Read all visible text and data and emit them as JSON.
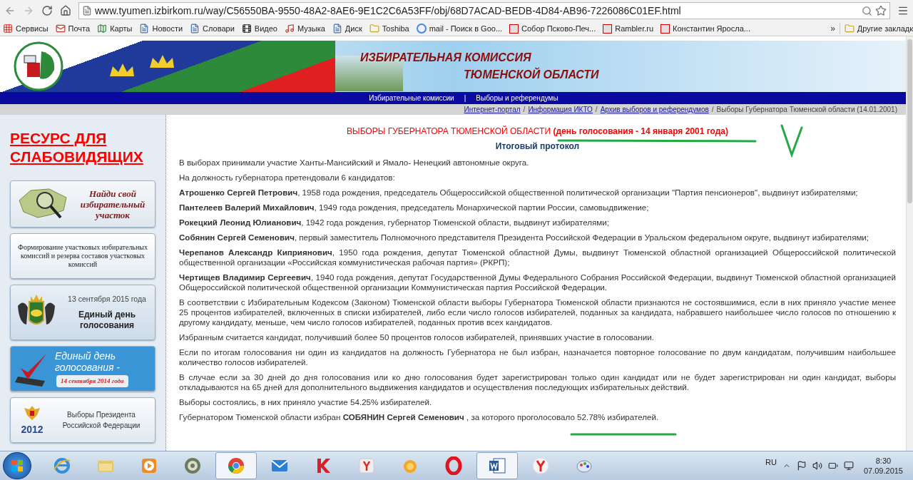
{
  "browser": {
    "url": "www.tyumen.izbirkom.ru/way/C56550BA-9550-48A2-8AE6-9E1C2C6A53FF/obj/68D7ACAD-BEDB-4D84-AB96-7226086C01EF.html",
    "bookmarks": [
      {
        "label": "Сервисы",
        "kind": "apps"
      },
      {
        "label": "Почта",
        "kind": "mail"
      },
      {
        "label": "Карты",
        "kind": "maps"
      },
      {
        "label": "Новости",
        "kind": "page"
      },
      {
        "label": "Словари",
        "kind": "page"
      },
      {
        "label": "Видео",
        "kind": "video"
      },
      {
        "label": "Музыка",
        "kind": "music"
      },
      {
        "label": "Диск",
        "kind": "page"
      },
      {
        "label": "Toshiba",
        "kind": "folder"
      },
      {
        "label": "mail - Поиск в Goo...",
        "kind": "google"
      },
      {
        "label": "Собор Псково-Печ...",
        "kind": "yandex"
      },
      {
        "label": "Rambler.ru",
        "kind": "yandex"
      },
      {
        "label": "Константин Яросла...",
        "kind": "yandex"
      }
    ],
    "more": "»",
    "other_bookmarks": "Другие закладк"
  },
  "site_header": {
    "title_lines": [
      "ИЗБИРАТЕЛЬНАЯ КОМИССИЯ",
      "ТЮМЕНСКОЙ ОБЛАСТИ"
    ]
  },
  "nav": {
    "links": [
      "Избирательные комиссии",
      "Выборы и референдумы"
    ],
    "separator": "|"
  },
  "breadcrumbs": {
    "links": [
      "Интернет-портал",
      "Информация ИКТО",
      "Архив выборов и референдумов"
    ],
    "separator": "/",
    "current": "Выборы Губернатора Тюменской области (14.01.2001)"
  },
  "sidebar": {
    "accessibility_link": "РЕСУРС ДЛЯ СЛАБОВИДЯЩИХ",
    "banners": [
      {
        "kind": "map",
        "title": "Найди свой избирательный участок"
      },
      {
        "kind": "text",
        "title": "Формирование участковых избирательных комиссий и резерва составов участковых комиссий"
      },
      {
        "kind": "emblem",
        "date": "13 сентября 2015 года",
        "title": "Единый день голосования"
      },
      {
        "kind": "ballot",
        "title": "Единый день голосования -",
        "date": "14 сентября 2014 года"
      },
      {
        "kind": "president",
        "date": "2012",
        "title": "Выборы Президента Российской Федерации"
      }
    ]
  },
  "article": {
    "title": "ВЫБОРЫ ГУБЕРНАТОРА ТЮМЕНСКОЙ ОБЛАСТИ **(день голосования - 14 января 2001 года)**",
    "subtitle": "Итоговый протокол",
    "paragraphs": [
      "В выборах принимали участие Ханты-Мансийский и Ямало- Ненецкий автономные округа.",
      "На должность губернатора претендовали 6 кандидатов:",
      "**Атрошенко Сергей Петрович**, 1958 года рождения, председатель Общероссийской общественной политической организации \"Партия пенсионеров\", выдвинут избирателями;",
      "**Пантелеев Валерий Михайлович**, 1949 года рождения, председатель Монархической партии России, самовыдвижение;",
      "**Рокецкий Леонид Юлианович**, 1942 года рождения, губернатор Тюменской области, выдвинут избирателями;",
      "**Собянин Сергей Семенович**, первый заместитель Полномочного представителя Президента Российской Федерации в Уральском федеральном округе, выдвинут избирателями;",
      "**Черепанов Александр Киприянович**, 1950 года рождения, депутат Тюменской областной Думы, выдвинут Тюменской областной организацией Общероссийской политической общественной организации «Российская коммунистическая рабочая партия» (РКРП);",
      "**Чертищев Владимир Сергеевич**, 1940 года рождения, депутат Государственной Думы Федерального Собрания Российской Федерации, выдвинут Тюменской областной организацией Общероссийской политической общественной организации Коммунистическая партия Российской Федерации.",
      "В соответствии с Избирательным Кодексом (Законом) Тюменской области выборы Губернатора Тюменской области признаются не состоявшимися, если в них приняло участие менее 25 процентов избирателей, включенных в списки избирателей, либо если число голосов избирателей, поданных за кандидата, набравшего наибольшее число голосов по отношению к другому кандидату, меньше, чем число голосов избирателей, поданных против всех кандидатов.",
      "Избранным считается кандидат, получивший более 50 процентов голосов избирателей, принявших участие в голосовании.",
      "Если по итогам голосования ни один из кандидатов на должность Губернатора не был избран, назначается повторное голосование по двум кандидатам, получившим наибольшее количество голосов избирателей.",
      "В случае если за 30 дней до дня голосования или ко дню голосования будет зарегистрирован только один кандидат или не будет зарегистрирован ни один кандидат, выборы откладываются на 65 дней для дополнительного выдвижения кандидатов и осуществления последующих избирательных действий.",
      "Выборы состоялись, в них приняло участие 54.25% избирателей.",
      "Губернатором Тюменской области избран **СОБЯНИН Сергей Семенович** , за которого проголосовало 52.78% избирателей."
    ]
  },
  "taskbar": {
    "apps": [
      {
        "kind": "ie",
        "selected": false
      },
      {
        "kind": "explorer",
        "selected": false
      },
      {
        "kind": "media",
        "selected": false
      },
      {
        "kind": "disc",
        "selected": false
      },
      {
        "kind": "chrome",
        "selected": true
      },
      {
        "kind": "mail",
        "selected": false
      },
      {
        "kind": "antivirus",
        "selected": false
      },
      {
        "kind": "yandex",
        "selected": false
      },
      {
        "kind": "orange",
        "selected": false
      },
      {
        "kind": "opera",
        "selected": false
      },
      {
        "kind": "word",
        "selected": true
      },
      {
        "kind": "yabrowser",
        "selected": false
      },
      {
        "kind": "paint",
        "selected": false
      }
    ],
    "language": "RU",
    "time": "8:30",
    "date": "07.09.2015"
  }
}
